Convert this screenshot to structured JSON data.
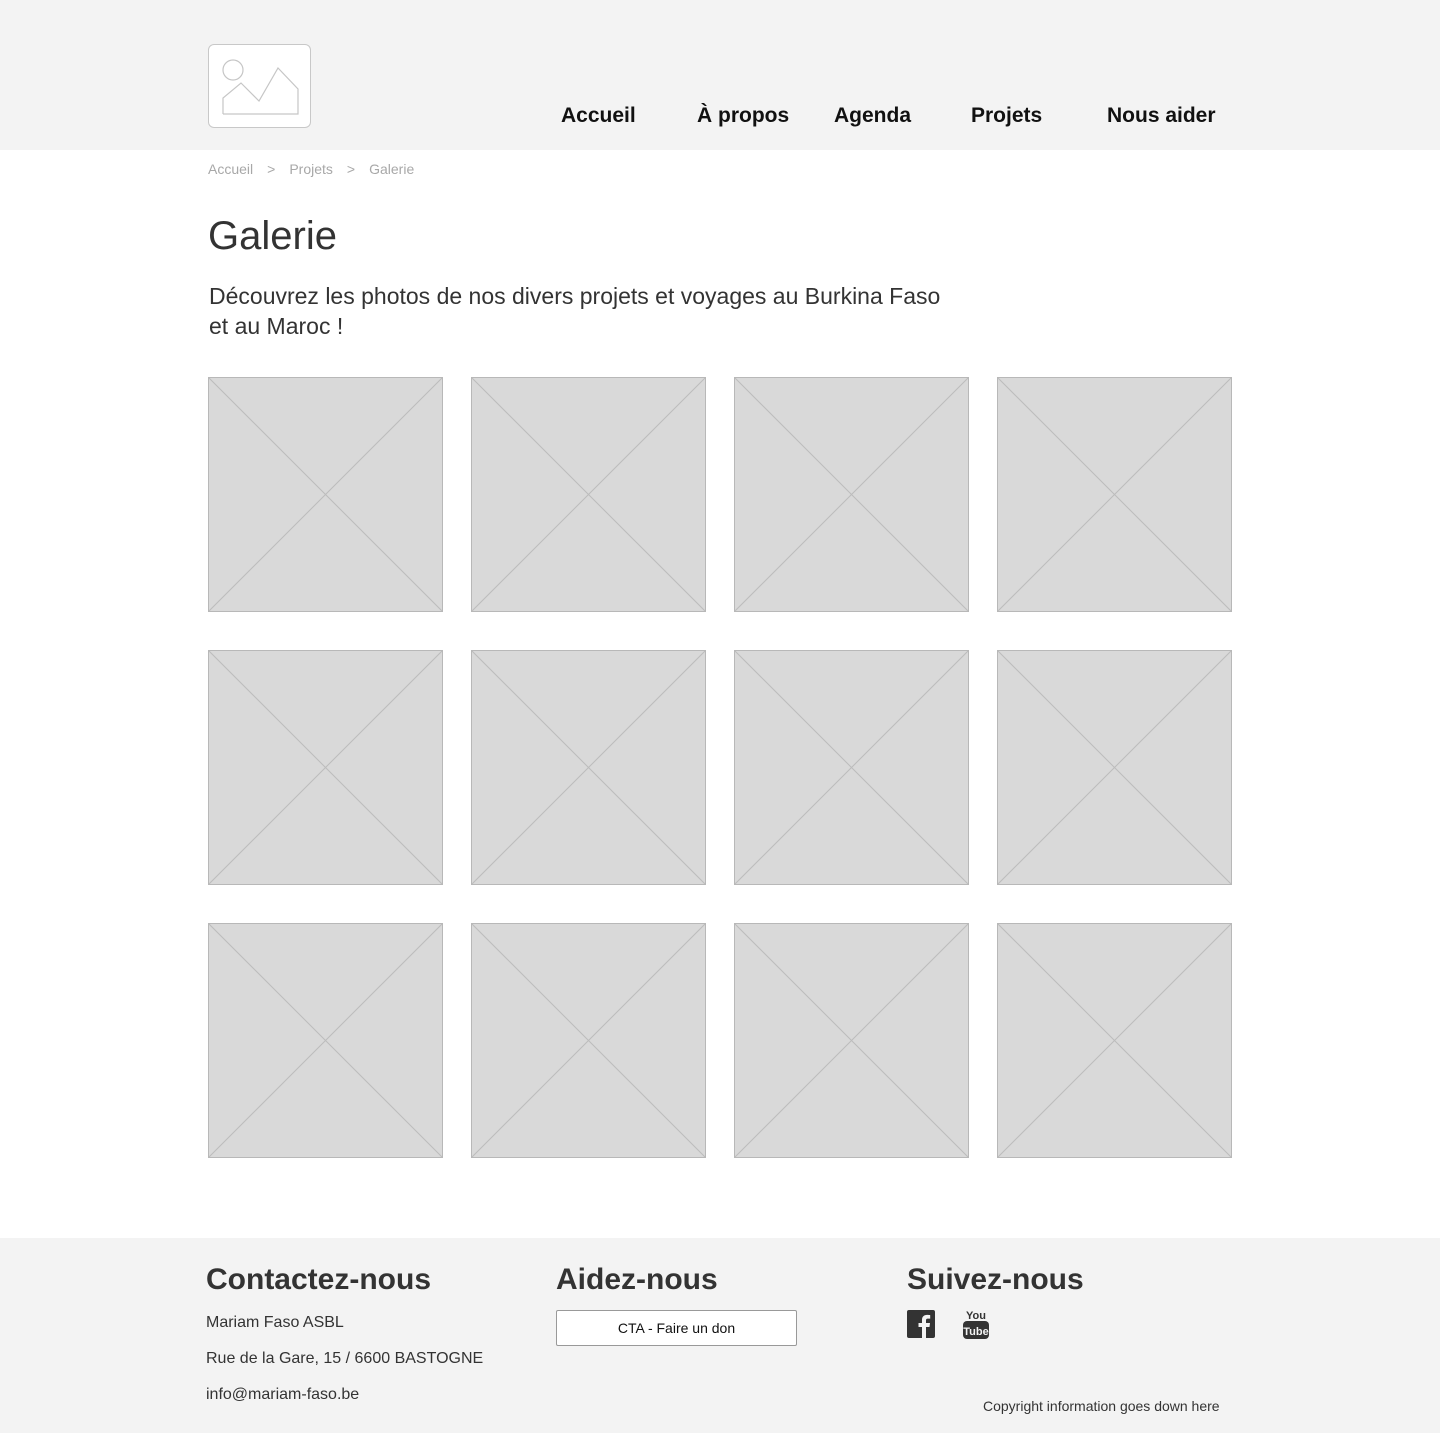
{
  "header": {
    "logo_icon": "image-placeholder-icon",
    "nav": [
      "Accueil",
      "À propos",
      "Agenda",
      "Projets",
      "Nous aider"
    ]
  },
  "breadcrumb": {
    "items": [
      "Accueil",
      "Projets",
      "Galerie"
    ],
    "separator": ">"
  },
  "main": {
    "title": "Galerie",
    "intro": "Découvrez les photos de nos divers projets et voyages au Burkina Faso et au Maroc !",
    "gallery_icon": "image-placeholder-icon"
  },
  "footer": {
    "contact": {
      "heading": "Contactez-nous",
      "lines": [
        "Mariam Faso ASBL",
        "Rue de la Gare, 15 / 6600 BASTOGNE",
        "info@mariam-faso.be"
      ]
    },
    "help": {
      "heading": "Aidez-nous",
      "cta_label": "CTA - Faire un don"
    },
    "follow": {
      "heading": "Suivez-nous",
      "icons": [
        "facebook-icon",
        "youtube-icon"
      ]
    },
    "copyright": "Copyright information goes down here"
  },
  "colors": {
    "band_background": "#f3f3f3",
    "placeholder_fill": "#d9d9d9",
    "placeholder_stroke": "#b8b8b8",
    "text": "#333333",
    "muted_text": "#a8a8a8"
  }
}
